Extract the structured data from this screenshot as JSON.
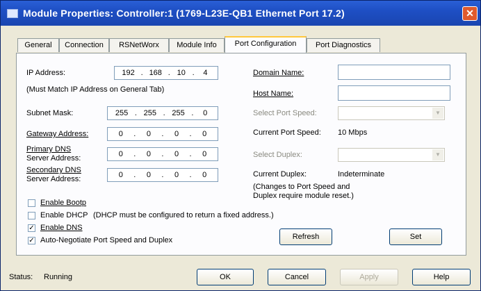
{
  "window": {
    "title": "Module Properties: Controller:1 (1769-L23E-QB1 Ethernet Port 17.2)",
    "close_glyph": "✕"
  },
  "tabs": [
    {
      "label": "General"
    },
    {
      "label": "Connection"
    },
    {
      "label": "RSNetWorx"
    },
    {
      "label": "Module Info"
    },
    {
      "label": "Port Configuration",
      "active": true
    },
    {
      "label": "Port Diagnostics"
    }
  ],
  "form": {
    "ip_label": "IP Address:",
    "ip_note": "(Must Match IP Address on General Tab)",
    "ip": [
      "192",
      "168",
      "10",
      "4"
    ],
    "subnet_label": "Subnet Mask:",
    "subnet": [
      "255",
      "255",
      "255",
      "0"
    ],
    "gateway_label": "Gateway Address:",
    "gateway": [
      "0",
      "0",
      "0",
      "0"
    ],
    "primary_dns_label": "Primary DNS\nServer Address:",
    "primary_dns_l1": "Primary DNS",
    "primary_dns_l2": "Server Address:",
    "primary_dns": [
      "0",
      "0",
      "0",
      "0"
    ],
    "secondary_dns_l1": "Secondary DNS",
    "secondary_dns_l2": "Server Address:",
    "secondary_dns": [
      "0",
      "0",
      "0",
      "0"
    ],
    "domain_label": "Domain Name:",
    "domain_value": "",
    "host_label": "Host Name:",
    "host_value": "",
    "select_port_speed_label": "Select Port Speed:",
    "current_port_speed_label": "Current Port Speed:",
    "current_port_speed_value": "10 Mbps",
    "select_duplex_label": "Select Duplex:",
    "current_duplex_label": "Current Duplex:",
    "current_duplex_value": "Indeterminate",
    "change_note_l1": "(Changes to Port Speed and",
    "change_note_l2": "Duplex require module reset.)",
    "enable_bootp": {
      "label": "Enable Bootp",
      "checked": false
    },
    "enable_dhcp": {
      "label": "Enable DHCP",
      "checked": false,
      "note": "(DHCP must be configured to return a fixed address.)"
    },
    "enable_dns": {
      "label": "Enable DNS",
      "checked": true
    },
    "auto_negotiate": {
      "label": "Auto-Negotiate Port Speed and Duplex",
      "checked": true
    },
    "refresh_label": "Refresh",
    "set_label": "Set"
  },
  "footer": {
    "status_label": "Status:",
    "status_value": "Running",
    "ok_label": "OK",
    "cancel_label": "Cancel",
    "apply_label": "Apply",
    "help_label": "Help"
  }
}
